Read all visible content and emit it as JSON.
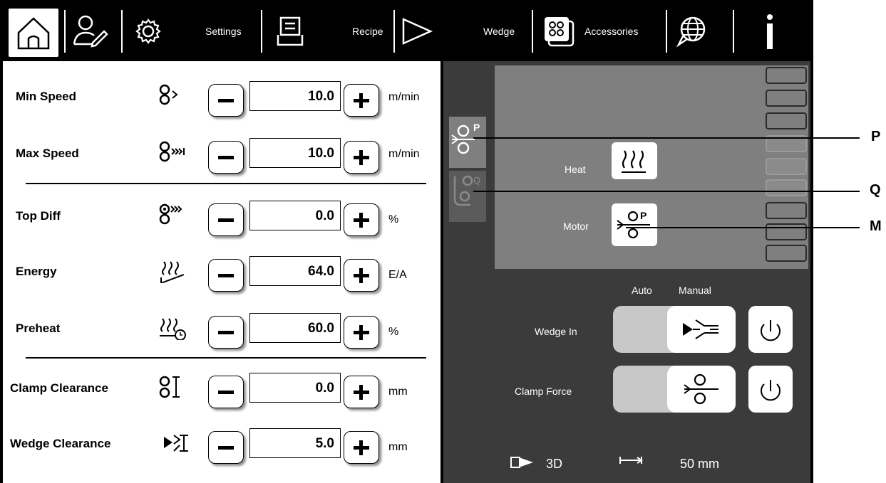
{
  "toolbar": {
    "settings_label": "Settings",
    "recipe_label": "Recipe",
    "wedge_label": "Wedge",
    "accessories_label": "Accessories"
  },
  "params": [
    {
      "name": "Min Speed",
      "value": "10.0",
      "unit": "m/min",
      "icon": "min-speed-icon"
    },
    {
      "name": "Max Speed",
      "value": "10.0",
      "unit": "m/min",
      "icon": "max-speed-icon"
    },
    {
      "name": "Top Diff",
      "value": "0.0",
      "unit": "%",
      "icon": "top-diff-icon"
    },
    {
      "name": "Energy",
      "value": "64.0",
      "unit": "E/A",
      "icon": "energy-icon"
    },
    {
      "name": "Preheat",
      "value": "60.0",
      "unit": "%",
      "icon": "preheat-icon"
    },
    {
      "name": "Clamp Clearance",
      "value": "0.0",
      "unit": "mm",
      "icon": "clamp-clearance-icon"
    },
    {
      "name": "Wedge Clearance",
      "value": "5.0",
      "unit": "mm",
      "icon": "wedge-clearance-icon"
    }
  ],
  "right": {
    "heat_label": "Heat",
    "motor_label": "Motor",
    "auto_label": "Auto",
    "manual_label": "Manual",
    "wedge_in_label": "Wedge In",
    "clamp_force_label": "Clamp Force",
    "mode_value": "3D",
    "width_value": "50 mm"
  },
  "callouts": {
    "p": "P",
    "q": "Q",
    "m": "M"
  },
  "colors": {
    "panel": "#3b3b3b",
    "gray_area": "#7f7f7f",
    "frame": "#000000"
  }
}
